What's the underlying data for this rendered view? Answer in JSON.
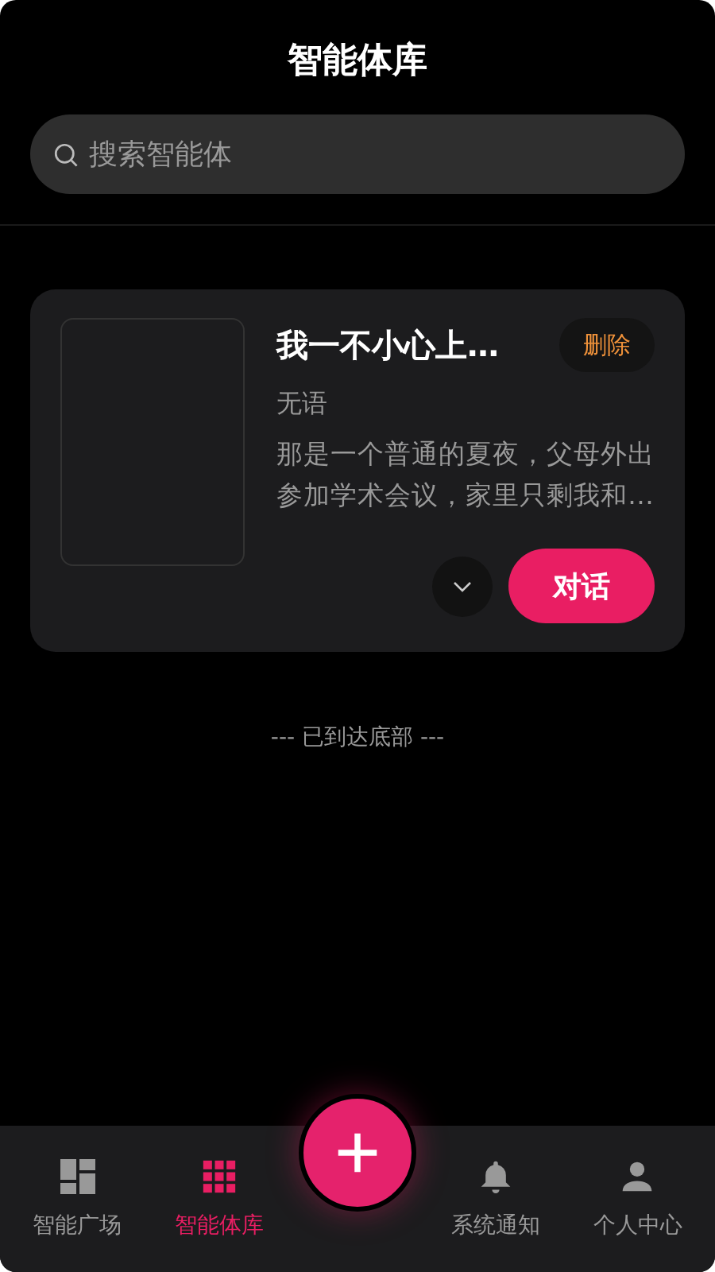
{
  "header": {
    "title": "智能体库"
  },
  "search": {
    "placeholder": "搜索智能体"
  },
  "agents": [
    {
      "name": "我一不小心上…",
      "delete_label": "删除",
      "tag": "无语",
      "description": "那是一个普通的夏夜，父母外出参加学术会议，家里只剩我和…",
      "chat_label": "对话"
    }
  ],
  "end_text": "--- 已到达底部 ---",
  "nav": [
    {
      "kind": "plaza",
      "label": "智能广场",
      "selected": false
    },
    {
      "kind": "library",
      "label": "智能体库",
      "selected": true
    },
    {
      "kind": "add"
    },
    {
      "kind": "notify",
      "label": "系统通知",
      "selected": false
    },
    {
      "kind": "profile",
      "label": "个人中心",
      "selected": false
    }
  ]
}
